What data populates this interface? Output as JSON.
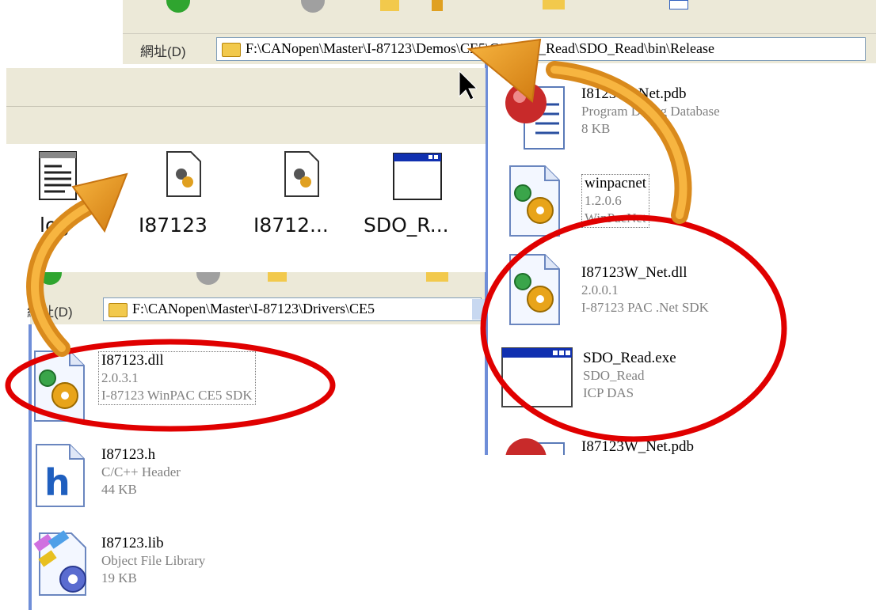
{
  "top_window": {
    "address_label": "網址(D)",
    "address_path": "F:\\CANopen\\Master\\I-87123\\Demos\\CE5\\C#\\SDO_Read\\SDO_Read\\bin\\Release"
  },
  "right_list": {
    "files": [
      {
        "name": "I8123W_Net.pdb",
        "line2": "Program Debug Database",
        "line3": "8 KB",
        "icon": "pdb-file-icon"
      },
      {
        "name": "winpacnet",
        "line2": "1.2.0.6",
        "line3": "WinPacNet",
        "icon": "dll-file-icon"
      },
      {
        "name": "I87123W_Net.dll",
        "line2": "2.0.0.1",
        "line3": "I-87123 PAC .Net SDK",
        "icon": "dll-file-icon"
      },
      {
        "name": "SDO_Read.exe",
        "line2": "SDO_Read",
        "line3": "ICP DAS",
        "icon": "exe-window-icon"
      },
      {
        "name": "I87123W_Net.pdb",
        "icon": "pdb-file-icon"
      }
    ]
  },
  "icon_view": {
    "items": [
      {
        "label": "log",
        "icon": "text-file-icon"
      },
      {
        "label": "I87123",
        "icon": "dll-file-icon"
      },
      {
        "label": "I8712...",
        "icon": "dll-file-icon"
      },
      {
        "label": "SDO_R...",
        "icon": "exe-window-icon"
      }
    ]
  },
  "bottom_window": {
    "address_label": "網址(D)",
    "address_path": "F:\\CANopen\\Master\\I-87123\\Drivers\\CE5",
    "files": [
      {
        "name": "I87123.dll",
        "line2": "2.0.3.1",
        "line3": "I-87123 WinPAC CE5 SDK",
        "icon": "dll-file-icon"
      },
      {
        "name": "I87123.h",
        "line2": "C/C++ Header",
        "line3": "44 KB",
        "icon": "header-file-icon"
      },
      {
        "name": "I87123.lib",
        "line2": "Object File Library",
        "line3": "19 KB",
        "icon": "lib-file-icon"
      }
    ]
  },
  "colors": {
    "highlight_ellipse": "#e00000",
    "arrow": "#f39a1e",
    "toolbar": "#ece9d8"
  }
}
